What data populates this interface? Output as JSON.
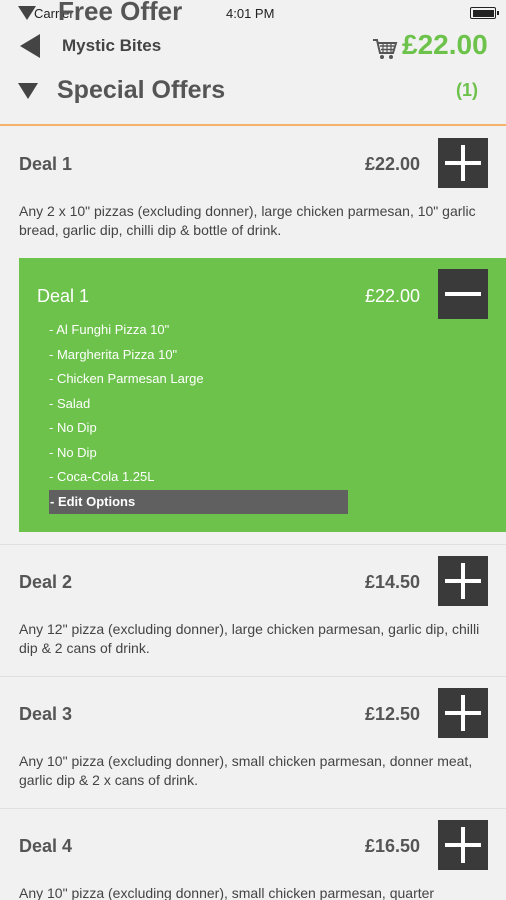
{
  "status_bar": {
    "carrier": "Carrier",
    "time": "4:01 PM"
  },
  "free_offer": {
    "title": "Free Offer"
  },
  "header": {
    "restaurant": "Mystic Bites",
    "cart_total": "£22.00"
  },
  "section": {
    "title": "Special Offers",
    "count": "(1)"
  },
  "deals": [
    {
      "title": "Deal 1",
      "price": "£22.00",
      "description": "Any 2 x 10\" pizzas (excluding donner), large chicken parmesan, 10\" garlic bread, garlic dip, chilli dip & bottle of drink."
    },
    {
      "title": "Deal 2",
      "price": "£14.50",
      "description": "Any 12\" pizza (excluding donner), large chicken parmesan, garlic dip, chilli dip & 2 cans of drink."
    },
    {
      "title": "Deal 3",
      "price": "£12.50",
      "description": "Any 10\" pizza (excluding donner), small chicken parmesan, donner meat, garlic dip & 2 x cans of drink."
    },
    {
      "title": "Deal 4",
      "price": "£16.50",
      "description": "Any 10\" pizza (excluding donner), small chicken parmesan, quarter"
    }
  ],
  "selected": {
    "title": "Deal 1",
    "price": "£22.00",
    "options": [
      "- Al Funghi Pizza 10\"",
      "- Margherita Pizza 10\"",
      "- Chicken Parmesan Large",
      "- Salad",
      "- No Dip",
      "- No Dip",
      "- Coca-Cola 1.25L"
    ],
    "edit_label": "- Edit Options"
  },
  "colors": {
    "accent_green": "#6cc24a",
    "dark_button": "#3a3a3a",
    "divider_orange": "#f5b26b"
  }
}
